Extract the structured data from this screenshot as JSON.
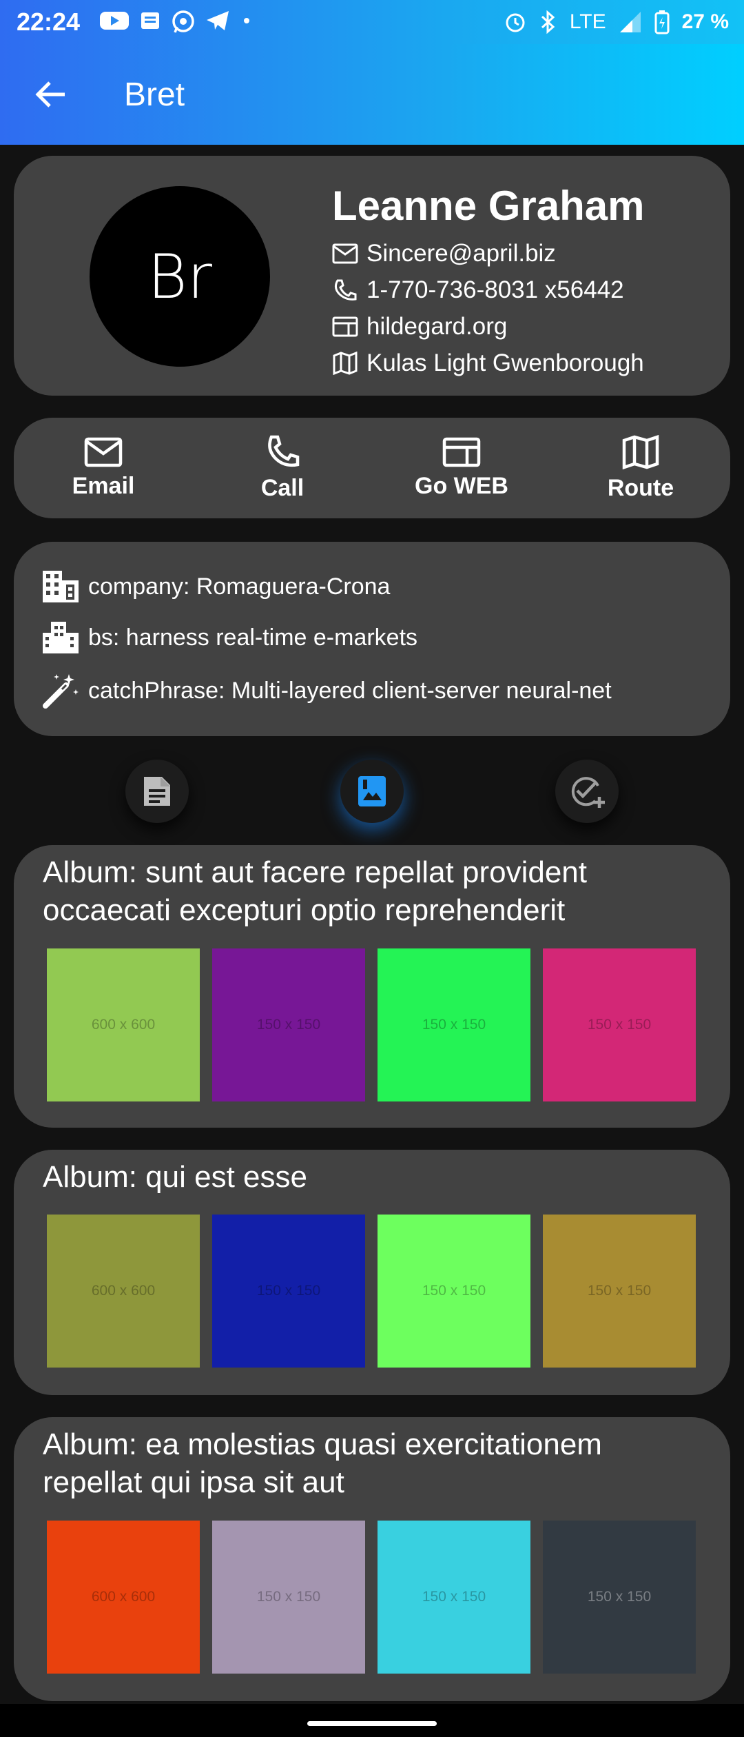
{
  "status": {
    "time": "22:24",
    "network": "LTE",
    "battery": "27 %",
    "icons": [
      "youtube-icon",
      "news-icon",
      "whatsapp-icon",
      "telegram-icon",
      "dot-icon",
      "alarm-icon",
      "bluetooth-icon",
      "signal-icon",
      "battery-icon"
    ]
  },
  "appbar": {
    "title": "Bret",
    "back_icon": "arrow-back-icon"
  },
  "profile": {
    "initials": "Br",
    "name": "Leanne Graham",
    "email": "Sincere@april.biz",
    "phone": "1-770-736-8031 x56442",
    "website": "hildegard.org",
    "address": "Kulas Light Gwenborough"
  },
  "actions": [
    {
      "label": "Email",
      "icon": "mail-icon"
    },
    {
      "label": "Call",
      "icon": "phone-icon"
    },
    {
      "label": "Go WEB",
      "icon": "web-icon"
    },
    {
      "label": "Route",
      "icon": "map-icon"
    }
  ],
  "company": {
    "name": "company: Romaguera-Crona",
    "bs": "bs: harness real-time e-markets",
    "catchphrase": "catchPhrase: Multi-layered client-server neural-net"
  },
  "tabs": [
    {
      "icon": "document-icon",
      "active": false
    },
    {
      "icon": "photo-album-icon",
      "active": true
    },
    {
      "icon": "task-add-icon",
      "active": false
    }
  ],
  "colors": {
    "accent": "#2196f3",
    "card": "#424242",
    "background": "#121212"
  },
  "albums": [
    {
      "title": "Album: sunt aut facere repellat provident occaecati excepturi optio reprehenderit",
      "photos": [
        {
          "label": "600 x 600",
          "color": "#92c952"
        },
        {
          "label": "150 x 150",
          "color": "#771796"
        },
        {
          "label": "150 x 150",
          "color": "#24f355"
        },
        {
          "label": "150 x 150",
          "color": "#d32776"
        }
      ]
    },
    {
      "title": "Album: qui est esse",
      "photos": [
        {
          "label": "600 x 600",
          "color": "#8e973b"
        },
        {
          "label": "150 x 150",
          "color": "#121fa8"
        },
        {
          "label": "150 x 150",
          "color": "#6dff5e"
        },
        {
          "label": "150 x 150",
          "color": "#a88c32"
        }
      ]
    },
    {
      "title": "Album: ea molestias quasi exercitationem repellat qui ipsa sit aut",
      "photos": [
        {
          "label": "600 x 600",
          "color": "#e9410d"
        },
        {
          "label": "150 x 150",
          "color": "#a495b0"
        },
        {
          "label": "150 x 150",
          "color": "#39d0e0"
        },
        {
          "label": "150 x 150",
          "color": "#323a42"
        }
      ]
    }
  ]
}
